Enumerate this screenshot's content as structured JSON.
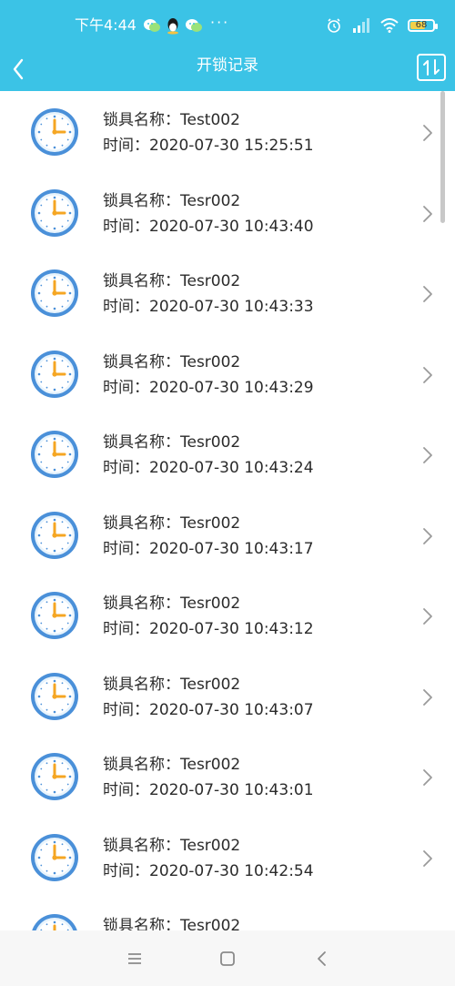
{
  "status_bar": {
    "time": "下午4:44",
    "dots": "···",
    "battery_level": 68,
    "battery_label": "68",
    "background": "#3bc3e6"
  },
  "nav": {
    "title": "开锁记录",
    "back_icon": "chevron-left-icon",
    "sort_icon": "sort-arrows-icon"
  },
  "records": [
    {
      "name": "锁具名称：Test002",
      "time": "时间：2020-07-30 15:25:51"
    },
    {
      "name": "锁具名称：Tesr002",
      "time": "时间：2020-07-30 10:43:40"
    },
    {
      "name": "锁具名称：Tesr002",
      "time": "时间：2020-07-30 10:43:33"
    },
    {
      "name": "锁具名称：Tesr002",
      "time": "时间：2020-07-30 10:43:29"
    },
    {
      "name": "锁具名称：Tesr002",
      "time": "时间：2020-07-30 10:43:24"
    },
    {
      "name": "锁具名称：Tesr002",
      "time": "时间：2020-07-30 10:43:17"
    },
    {
      "name": "锁具名称：Tesr002",
      "time": "时间：2020-07-30 10:43:12"
    },
    {
      "name": "锁具名称：Tesr002",
      "time": "时间：2020-07-30 10:43:07"
    },
    {
      "name": "锁具名称：Tesr002",
      "time": "时间：2020-07-30 10:43:01"
    },
    {
      "name": "锁具名称：Tesr002",
      "time": "时间：2020-07-30 10:42:54"
    },
    {
      "name": "锁具名称：Tesr002",
      "time": ""
    }
  ],
  "record_icon": "clock-icon",
  "colors": {
    "accent": "#3bc3e6",
    "clock_ring": "#4a90d9",
    "clock_face": "#e8f4fd",
    "clock_hand": "#f5a623"
  },
  "system_nav": {
    "menu_icon": "menu-lines-icon",
    "home_icon": "square-home-icon",
    "back_icon": "triangle-back-icon"
  }
}
